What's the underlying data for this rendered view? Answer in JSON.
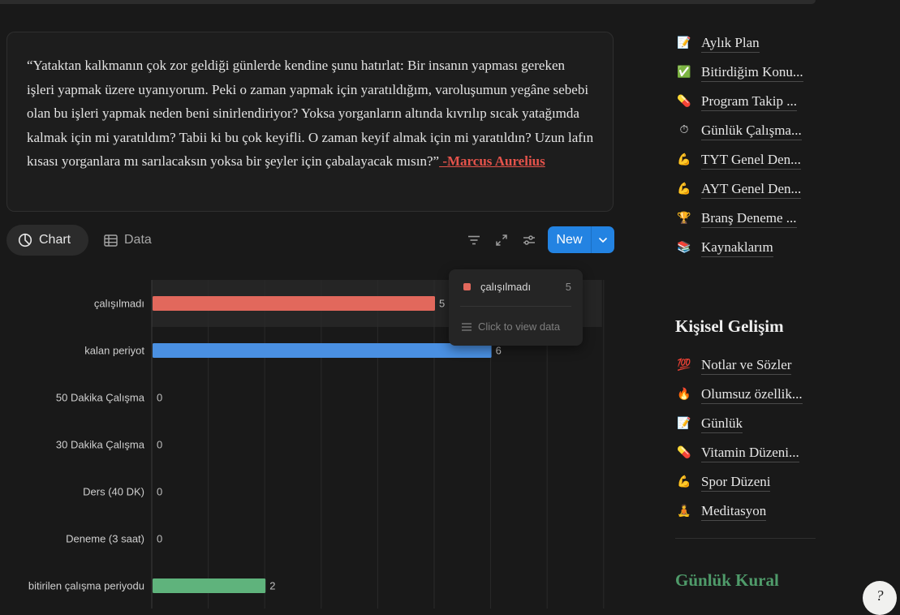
{
  "quote": {
    "text": "“Yataktan kalkmanın çok zor geldiği günlerde kendine şunu hatırlat: Bir insanın yapması gereken işleri yapmak üzere uyanıyorum. Peki o zaman yapmak için yaratıldığım, varoluşumun yegâne sebebi olan bu işleri yapmak neden beni sinirlendiriyor? Yoksa yorganların altında kıvrılıp sıcak yatağımda kalmak için mi yaratıldım? Tabii ki bu çok keyifli. O zaman keyif almak için mi yaratıldın? Uzun lafın kısası yorganlara mı sarılacaksın yoksa bir şeyler için çabalayacak mısın?”",
    "author": " -Marcus Aurelius"
  },
  "views": {
    "chart_label": "Chart",
    "data_label": "Data"
  },
  "toolbar": {
    "new_label": "New"
  },
  "chart_data": {
    "type": "bar",
    "orientation": "horizontal",
    "categories": [
      "çalışılmadı",
      "kalan periyot",
      "50 Dakika Çalışma",
      "30 Dakika Çalışma",
      "Ders (40 DK)",
      "Deneme (3 saat)",
      "bitirilen çalışma periyodu"
    ],
    "values": [
      5,
      6,
      0,
      0,
      0,
      0,
      2
    ],
    "colors": [
      "#e2685c",
      "#4a90e2",
      "#4a90e2",
      "#4a90e2",
      "#4a90e2",
      "#4a90e2",
      "#5fb37c"
    ],
    "highlighted": "çalışılmadı",
    "xlim": [
      0,
      8
    ],
    "grid": true
  },
  "tooltip": {
    "label": "çalışılmadı",
    "count": "5",
    "action": "Click to view data",
    "color": "#e2685c"
  },
  "sidebar": {
    "top_items": [
      {
        "icon": "📝",
        "label": "Aylık Plan"
      },
      {
        "icon": "✅",
        "label": "Bitirdiğim Konu..."
      },
      {
        "icon": "💊",
        "label": "Program Takip ..."
      },
      {
        "icon": "⏱",
        "label": "Günlük Çalışma..."
      },
      {
        "icon": "💪",
        "label": "TYT Genel Den..."
      },
      {
        "icon": "💪",
        "label": "AYT Genel Den..."
      },
      {
        "icon": "🏆",
        "label": "Branş Deneme ..."
      },
      {
        "icon": "📚",
        "label": "Kaynaklarım"
      }
    ],
    "section_title": "Kişisel Gelişim",
    "section_items": [
      {
        "icon": "💯",
        "label": "Notlar ve Sözler"
      },
      {
        "icon": "🔥",
        "label": "Olumsuz özellik..."
      },
      {
        "icon": "📝",
        "label": "Günlük"
      },
      {
        "icon": "💊",
        "label": "Vitamin Düzeni..."
      },
      {
        "icon": "💪",
        "label": "Spor Düzeni"
      },
      {
        "icon": "🧘",
        "label": "Meditasyon"
      }
    ],
    "footer_title": "Günlük Kural"
  },
  "fab_icon": "help-icon"
}
